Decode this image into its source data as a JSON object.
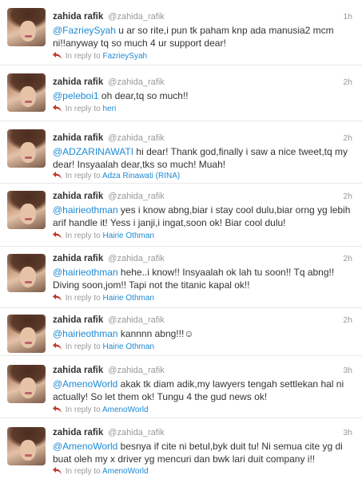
{
  "accent_color": "#1d8ad4",
  "tweets": [
    {
      "full_name": "zahida rafik",
      "screen_name": "@zahida_rafik",
      "time": "1h",
      "mention": "@FazrieySyah",
      "text": " u ar so rite,i pun tk paham knp ada manusia2 mcm ni!!anyway tq so much 4 ur support dear!",
      "reply_prefix": "In reply to",
      "reply_to": "FazrieySyah"
    },
    {
      "full_name": "zahida rafik",
      "screen_name": "@zahida_rafik",
      "time": "2h",
      "mention": "@peleboi1",
      "text": " oh dear,tq so much!!",
      "reply_prefix": "In reply to",
      "reply_to": "heri"
    },
    {
      "full_name": "zahida rafik",
      "screen_name": "@zahida_rafik",
      "time": "2h",
      "mention": "@ADZARINAWATI",
      "text": " hi dear! Thank god,finally i saw a nice tweet,tq my dear! Insyaalah dear,tks so much! Muah!",
      "reply_prefix": "In reply to",
      "reply_to": "Adza Rinawati (RINA)"
    },
    {
      "full_name": "zahida rafik",
      "screen_name": "@zahida_rafik",
      "time": "2h",
      "mention": "@hairieothman",
      "text": " yes i know abng,biar i stay cool dulu,biar orng yg lebih arif handle it! Yess i janji,i ingat,soon ok! Biar cool dulu!",
      "reply_prefix": "In reply to",
      "reply_to": "Hairie Othman"
    },
    {
      "full_name": "zahida rafik",
      "screen_name": "@zahida_rafik",
      "time": "2h",
      "mention": "@hairieothman",
      "text": " hehe..i know!! Insyaalah ok lah tu soon!! Tq abng!! Diving soon,jom!! Tapi not the titanic kapal ok!!",
      "reply_prefix": "In reply to",
      "reply_to": "Hairie Othman"
    },
    {
      "full_name": "zahida rafik",
      "screen_name": "@zahida_rafik",
      "time": "2h",
      "mention": "@hairieothman",
      "text": " kannnn abng!!!☺",
      "reply_prefix": "In reply to",
      "reply_to": "Hairie Othman"
    },
    {
      "full_name": "zahida rafik",
      "screen_name": "@zahida_rafik",
      "time": "3h",
      "mention": "@AmenoWorld",
      "text": " akak tk diam adik,my lawyers tengah settlekan hal ni actually! So let them ok! Tungu 4 the gud news ok!",
      "reply_prefix": "In reply to",
      "reply_to": "AmenoWorld"
    },
    {
      "full_name": "zahida rafik",
      "screen_name": "@zahida_rafik",
      "time": "3h",
      "mention": "@AmenoWorld",
      "text": " besnya if cite ni betul,byk duit tu! Ni semua cite yg di buat oleh my x driver yg mencuri dan bwk lari duit company i!!",
      "reply_prefix": "In reply to",
      "reply_to": "AmenoWorld"
    }
  ]
}
